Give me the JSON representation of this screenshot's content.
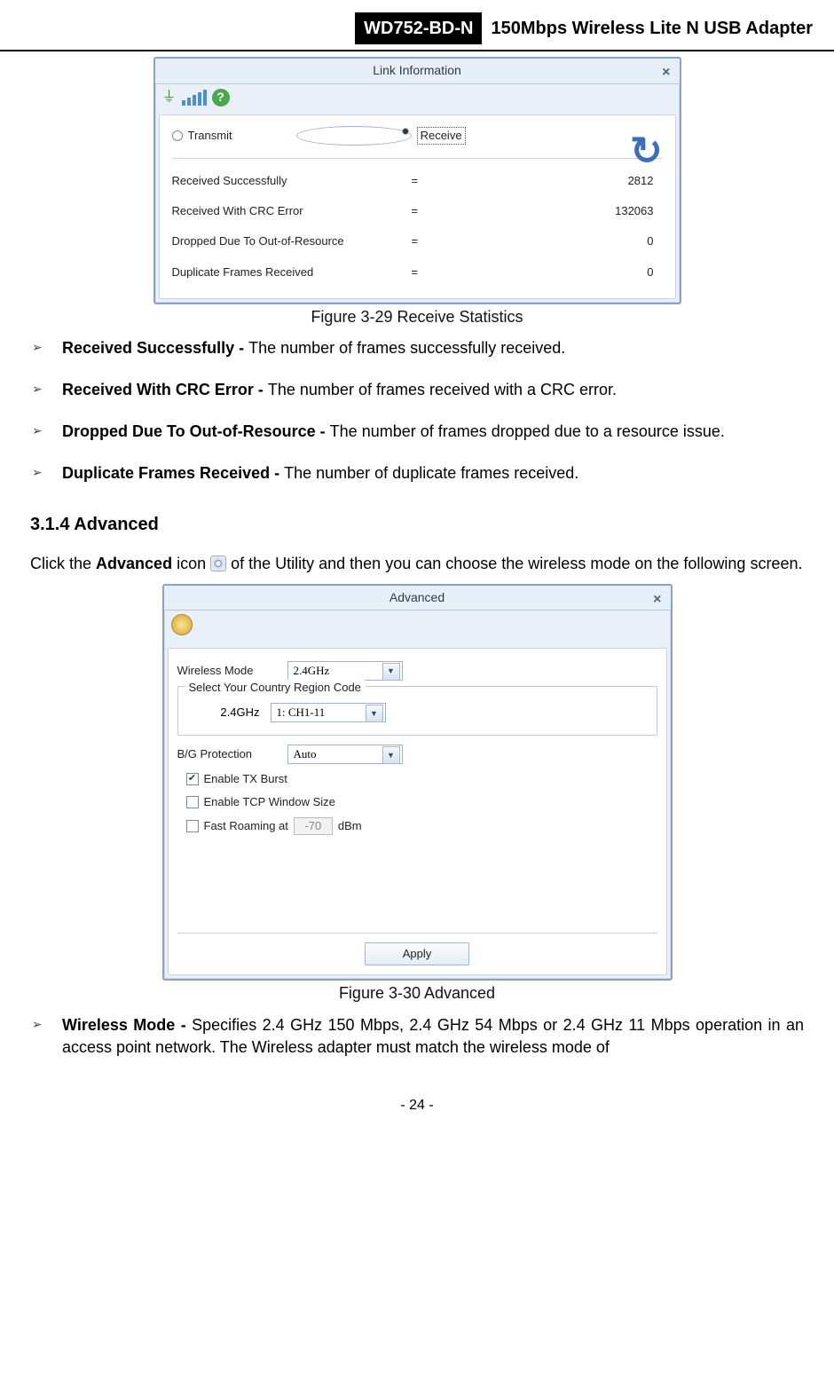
{
  "header": {
    "model": "WD752-BD-N",
    "desc": "150Mbps Wireless Lite N USB Adapter"
  },
  "fig1": {
    "title": "Link Information",
    "radio_transmit": "Transmit",
    "radio_receive": "Receive",
    "rows": [
      {
        "label": "Received Successfully",
        "eq": "=",
        "val": "2812"
      },
      {
        "label": "Received With CRC Error",
        "eq": "=",
        "val": "132063"
      },
      {
        "label": "Dropped Due To Out-of-Resource",
        "eq": "=",
        "val": "0"
      },
      {
        "label": "Duplicate Frames Received",
        "eq": "=",
        "val": "0"
      }
    ],
    "caption": "Figure 3-29 Receive Statistics"
  },
  "bullets1": [
    {
      "b": "Received Successfully - ",
      "t": "The number of frames successfully received."
    },
    {
      "b": "Received With CRC Error - ",
      "t": "The number of frames received with a CRC error."
    },
    {
      "b": "Dropped Due To Out-of-Resource - ",
      "t": "The number of frames dropped due to a resource issue."
    },
    {
      "b": "Duplicate Frames Received - ",
      "t": "The number of duplicate frames received."
    }
  ],
  "section": "3.1.4  Advanced",
  "para": {
    "p1": "Click the ",
    "p2": "Advanced",
    "p3": " icon ",
    "p4": " of the Utility and then you can choose the wireless mode on the following screen."
  },
  "fig2": {
    "title": "Advanced",
    "wm_label": "Wireless Mode",
    "wm_value": "2.4GHz",
    "region_legend": "Select Your Country Region Code",
    "region_label": "2.4GHz",
    "region_value": "1: CH1-11",
    "bg_label": "B/G Protection",
    "bg_value": "Auto",
    "chk_tx": "Enable TX Burst",
    "chk_tcp": "Enable TCP Window Size",
    "chk_roam_pre": "Fast Roaming at",
    "roam_val": "-70",
    "roam_unit": "dBm",
    "apply": "Apply",
    "caption": "Figure 3-30 Advanced"
  },
  "bullets2": [
    {
      "b": "Wireless Mode - ",
      "t": "Specifies 2.4 GHz 150 Mbps, 2.4 GHz 54 Mbps or 2.4 GHz 11 Mbps operation in an access point network. The Wireless adapter must match the wireless mode of"
    }
  ],
  "page": "- 24 -"
}
